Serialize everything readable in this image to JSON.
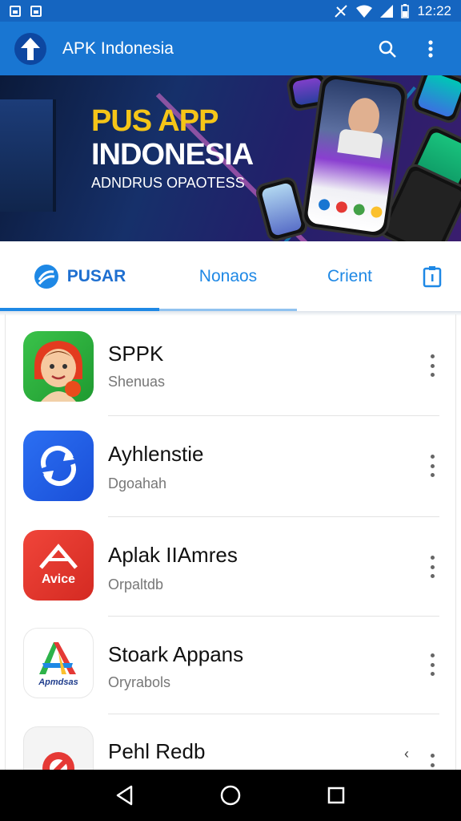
{
  "status_bar": {
    "time": "12:22"
  },
  "app_bar": {
    "title": "APK Indonesia"
  },
  "banner": {
    "line1": "PUS APP",
    "line2": "INDONESIA",
    "line3": "ADNDRUS OPAOTESS"
  },
  "tabs": [
    {
      "label": "PUSAR",
      "active": true
    },
    {
      "label": "Nonaos",
      "active": false
    },
    {
      "label": "Crient",
      "active": false
    }
  ],
  "apps": [
    {
      "name": "SPPK",
      "subtitle": "Shenuas"
    },
    {
      "name": "Ayhlenstie",
      "subtitle": "Dgoahah"
    },
    {
      "name": "Aplak IIAmres",
      "subtitle": "Orpaltdb",
      "icon_text": "Avice"
    },
    {
      "name": "Stoark Appans",
      "subtitle": "Oryrabols",
      "icon_text": "Apmdsas"
    },
    {
      "name": "Pehl Redb",
      "subtitle": ""
    }
  ],
  "colors": {
    "primary": "#1976d2",
    "status_bar": "#1565c0",
    "accent": "#1e88e5"
  }
}
